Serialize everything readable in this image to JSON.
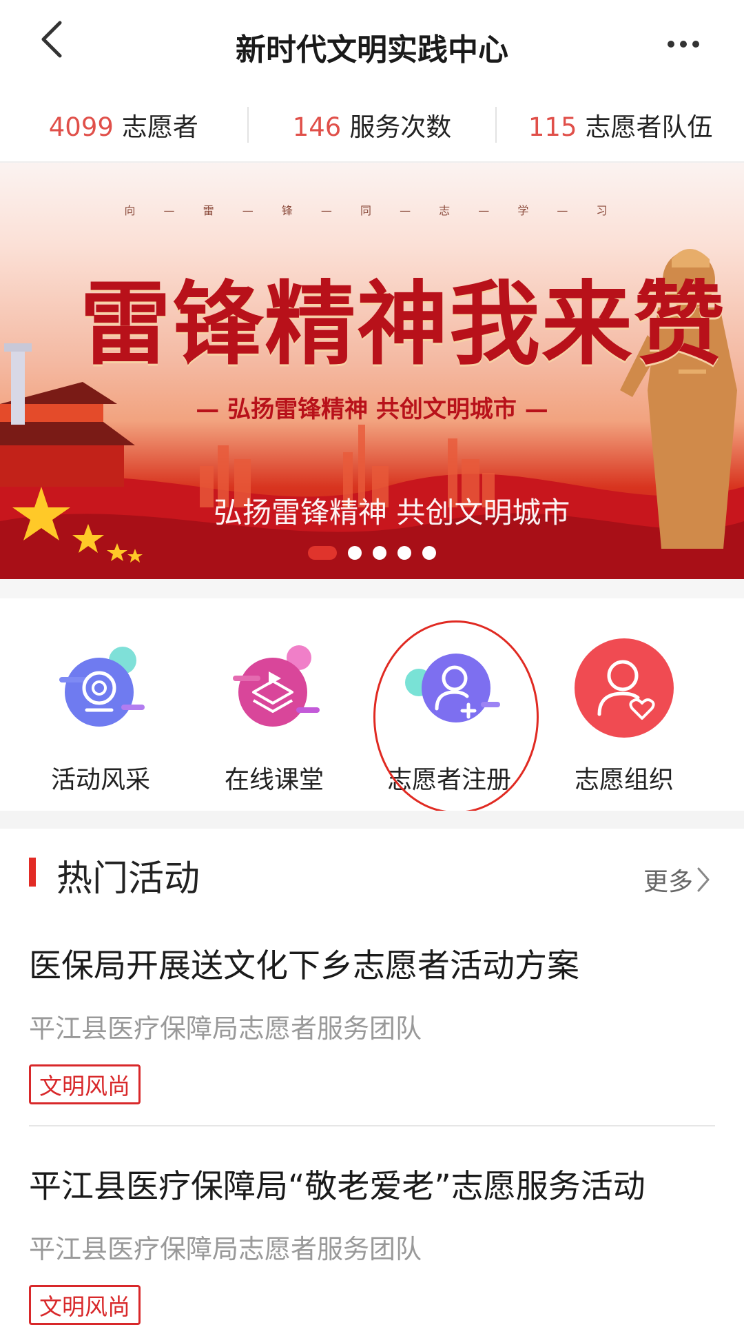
{
  "header": {
    "title": "新时代文明实践中心",
    "back_icon": "chevron-left-icon",
    "more_icon": "more-dots-icon"
  },
  "stats": [
    {
      "value": "4099",
      "label": "志愿者"
    },
    {
      "value": "146",
      "label": "服务次数"
    },
    {
      "value": "115",
      "label": "志愿者队伍"
    }
  ],
  "banner": {
    "top_text": "向 — 雷 — 锋 — 同 — 志 — 学 — 习",
    "title": "雷锋精神我来赞",
    "subtitle": "— 弘扬雷锋精神 共创文明城市 —",
    "caption": "弘扬雷锋精神 共创文明城市",
    "slide_count": 5,
    "active_slide": 1
  },
  "menu": [
    {
      "label": "活动风采",
      "icon": "camera-icon"
    },
    {
      "label": "在线课堂",
      "icon": "play-stack-icon"
    },
    {
      "label": "志愿者注册",
      "icon": "add-user-icon"
    },
    {
      "label": "志愿组织",
      "icon": "user-heart-icon"
    }
  ],
  "hot": {
    "title": "热门活动",
    "more": "更多",
    "items": [
      {
        "title": "医保局开展送文化下乡志愿者活动方案",
        "org": "平江县医疗保障局志愿者服务团队",
        "tag": "文明风尚"
      },
      {
        "title": "平江县医疗保障局“敬老爱老”志愿服务活动",
        "org": "平江县医疗保障局志愿者服务团队",
        "tag": "文明风尚"
      }
    ]
  },
  "colors": {
    "accent": "#e22b25",
    "stat_number": "#e0504a",
    "muted_text": "#999999"
  }
}
